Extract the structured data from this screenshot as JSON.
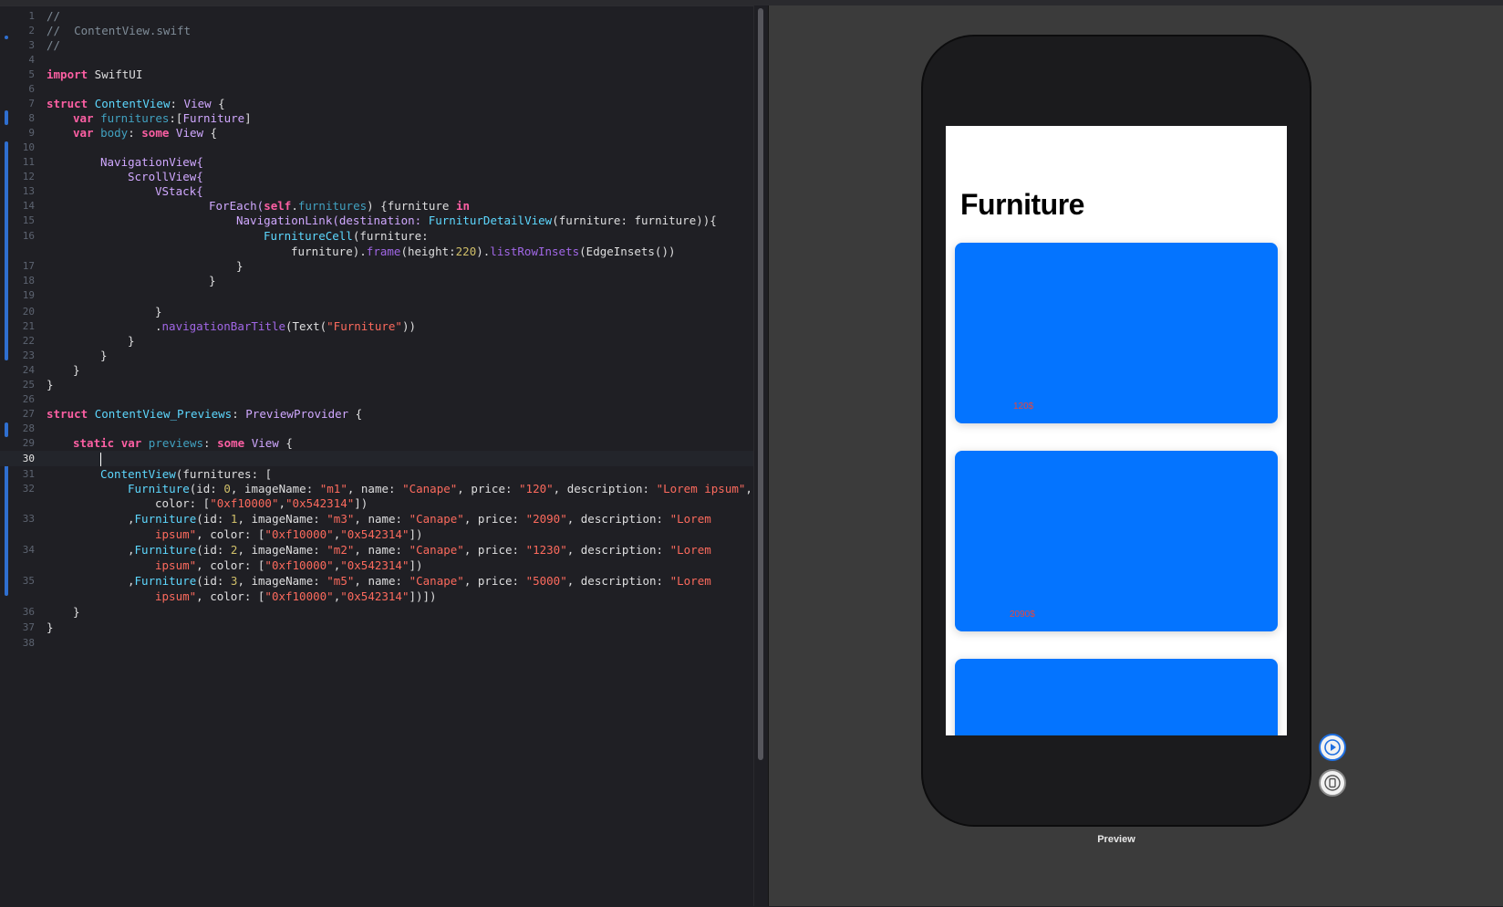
{
  "editor": {
    "file_comment": "//  ContentView.swift",
    "current_line": 30
  },
  "code": {
    "l1": "//",
    "l2": "//  ContentView.swift",
    "l3": "//",
    "l5a": "import",
    "l5b": " SwiftUI",
    "l7a": "struct",
    "l7b": "ContentView",
    "l7c": ": ",
    "l7d": "View",
    "l7e": " {",
    "l8a": "var",
    "l8b": "furnitures",
    "l8c": ":[",
    "l8d": "Furniture",
    "l8e": "]",
    "l9a": "var",
    "l9b": "body",
    "l9c": ": ",
    "l9d": "some",
    "l9e": "View",
    "l9f": " {",
    "l11": "NavigationView{",
    "l12": "ScrollView{",
    "l13": "VStack{",
    "l14a": "ForEach(",
    "l14b": "self",
    "l14c": ".",
    "l14d": "furnitures",
    "l14e": ") {furniture ",
    "l14f": "in",
    "l15a": "NavigationLink(destination: ",
    "l15b": "FurniturDetailView",
    "l15c": "(furniture: furniture)){",
    "l16a": "FurnitureCell",
    "l16b": "(furniture:",
    "l16c": "furniture).",
    "l16d": "frame",
    "l16e": "(height:",
    "l16f": "220",
    "l16g": ").",
    "l16h": "listRowInsets",
    "l16i": "(EdgeInsets())",
    "l17": "}",
    "l18": "}",
    "l20": "}",
    "l21a": ".",
    "l21b": "navigationBarTitle",
    "l21c": "(Text(",
    "l21d": "\"Furniture\"",
    "l21e": "))",
    "l22": "}",
    "l23": "}",
    "l24": "}",
    "l25": "}",
    "l27a": "struct",
    "l27b": "ContentView_Previews",
    "l27c": ": ",
    "l27d": "PreviewProvider",
    "l27e": " {",
    "l29a": "static",
    "l29b": "var",
    "l29c": "previews",
    "l29d": ": ",
    "l29e": "some",
    "l29f": "View",
    "l29g": " {",
    "l31a": "ContentView",
    "l31b": "(furnitures: [",
    "l32a": "Furniture",
    "l32b": "(id: ",
    "l32c": "0",
    "l32d": ", imageName: ",
    "l32e": "\"m1\"",
    "l32f": ", name: ",
    "l32g": "\"Canape\"",
    "l32h": ", price: ",
    "l32i": "\"120\"",
    "l32j": ", description: ",
    "l32k": "\"Lorem ipsum\"",
    "l32l": ",",
    "l32m": "color: [",
    "l32n": "\"0xf10000\"",
    "l32o": ",",
    "l32p": "\"0x542314\"",
    "l32q": "])",
    "l33a": ",",
    "l33b": "Furniture",
    "l33c": "(id: ",
    "l33d": "1",
    "l33e": ", imageName: ",
    "l33f": "\"m3\"",
    "l33g": ", name: ",
    "l33h": "\"Canape\"",
    "l33i": ", price: ",
    "l33j": "\"2090\"",
    "l33k": ", description: ",
    "l33l": "\"Lorem",
    "l33m": "ipsum\"",
    "l33n": ", color: [",
    "l33o": "\"0xf10000\"",
    "l33p": ",",
    "l33q": "\"0x542314\"",
    "l33r": "])",
    "l34a": ",",
    "l34b": "Furniture",
    "l34c": "(id: ",
    "l34d": "2",
    "l34e": ", imageName: ",
    "l34f": "\"m2\"",
    "l34g": ", name: ",
    "l34h": "\"Canape\"",
    "l34i": ", price: ",
    "l34j": "\"1230\"",
    "l34k": ", description: ",
    "l34l": "\"Lorem",
    "l34m": "ipsum\"",
    "l34n": ", color: [",
    "l34o": "\"0xf10000\"",
    "l34p": ",",
    "l34q": "\"0x542314\"",
    "l34r": "])",
    "l35a": ",",
    "l35b": "Furniture",
    "l35c": "(id: ",
    "l35d": "3",
    "l35e": ", imageName: ",
    "l35f": "\"m5\"",
    "l35g": ", name: ",
    "l35h": "\"Canape\"",
    "l35i": ", price: ",
    "l35j": "\"5000\"",
    "l35k": ", description: ",
    "l35l": "\"Lorem",
    "l35m": "ipsum\"",
    "l35n": ", color: [",
    "l35o": "\"0xf10000\"",
    "l35p": ",",
    "l35q": "\"0x542314\"",
    "l35r": "])])",
    "l36": "}",
    "l37": "}"
  },
  "line_numbers": [
    "1",
    "2",
    "3",
    "4",
    "5",
    "6",
    "7",
    "8",
    "9",
    "10",
    "11",
    "12",
    "13",
    "14",
    "15",
    "16",
    "17",
    "18",
    "19",
    "20",
    "21",
    "22",
    "23",
    "24",
    "25",
    "26",
    "27",
    "28",
    "29",
    "30",
    "31",
    "32",
    "33",
    "34",
    "35",
    "36",
    "37",
    "38"
  ],
  "preview": {
    "nav_title": "Furniture",
    "cards": [
      {
        "price": "120$"
      },
      {
        "price": "2090$"
      },
      {
        "price": ""
      }
    ],
    "label": "Preview",
    "controls": {
      "live": "play-icon",
      "device": "device-icon"
    }
  },
  "colors": {
    "card": "#0474ff",
    "keyword": "#fc5fa3",
    "type": "#5dd8ff",
    "string": "#fc6a5d",
    "number": "#d0bf69"
  }
}
